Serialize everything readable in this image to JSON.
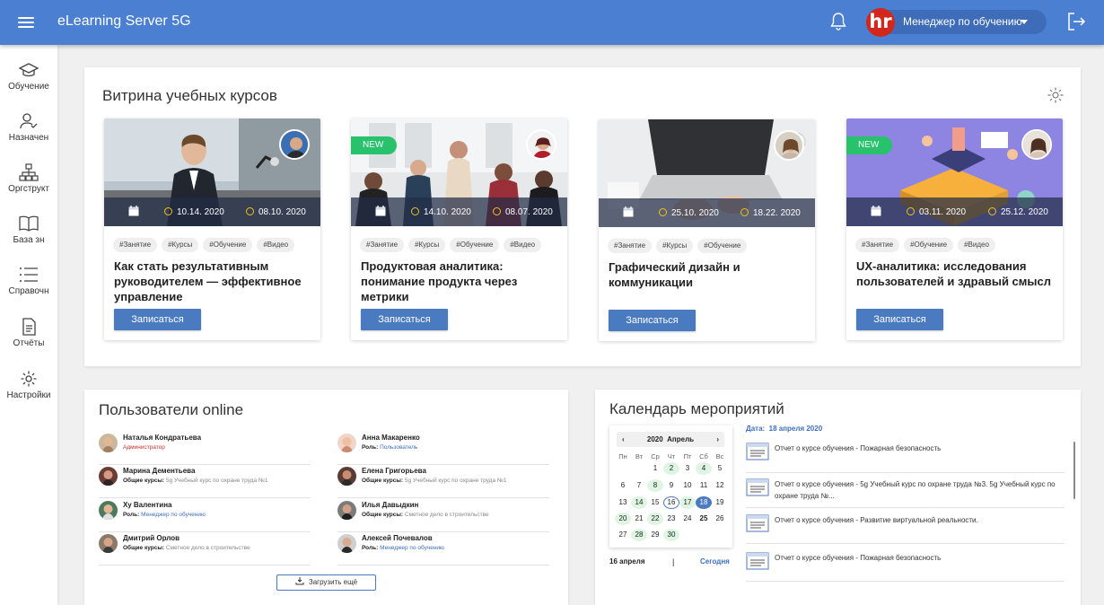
{
  "topbar": {
    "title": "eLearning Server 5G",
    "user_initial": "hr",
    "user_name": "Менеджер по обучению"
  },
  "sidebar": {
    "items": [
      {
        "label": "Обучение"
      },
      {
        "label": "Назначен"
      },
      {
        "label": "Оргструкт"
      },
      {
        "label": "База зн"
      },
      {
        "label": "Справочн"
      },
      {
        "label": "Отчёты"
      },
      {
        "label": "Настройки"
      }
    ]
  },
  "showcase": {
    "title": "Витрина учебных курсов",
    "courses": [
      {
        "date_start": "10.14. 2020",
        "date_end": "08.10. 2020",
        "new": "",
        "tags": [
          "#Занятие",
          "#Курсы",
          "#Обучение",
          "#Видео"
        ],
        "title": "Как стать результативным руководителем — эффективное управление",
        "button": "Записаться"
      },
      {
        "date_start": "14.10. 2020",
        "date_end": "08.07. 2020",
        "new": "NEW",
        "tags": [
          "#Занятие",
          "#Курсы",
          "#Обучение",
          "#Видео"
        ],
        "title": "Продуктовая аналитика: понимание продукта через метрики",
        "button": "Записаться"
      },
      {
        "date_start": "25.10. 2020",
        "date_end": "18.22. 2020",
        "new": "",
        "tags": [
          "#Занятие",
          "#Курсы",
          "#Обучение"
        ],
        "title": "Графический дизайн и коммуникации",
        "button": "Записаться"
      },
      {
        "date_start": "03.11. 2020",
        "date_end": "25.12. 2020",
        "new": "NEW",
        "tags": [
          "#Занятие",
          "#Обучение",
          "#Видео"
        ],
        "title": "UX-аналитика: исследования пользователей и здравый смысл",
        "button": "Записаться"
      }
    ]
  },
  "online": {
    "title": "Пользователи online",
    "load_more": "Загрузить ещё",
    "users": [
      {
        "name": "Наталья Кондратьева",
        "key": "",
        "value": "Администратор"
      },
      {
        "name": "Марина Дементьева",
        "key": "Общие курсы:",
        "value": "5g Учебный курс по охране труда №1"
      },
      {
        "name": "Ху Валентина",
        "key": "Роль:",
        "value": "Менеджер по обучению"
      },
      {
        "name": "Дмитрий Орлов",
        "key": "Общие курсы:",
        "value": "Сметное дело в строительстве"
      },
      {
        "name": "Анна Макаренко",
        "key": "Роль:",
        "value": "Пользователь"
      },
      {
        "name": "Елена Григорьева",
        "key": "Общие курсы:",
        "value": "5g Учебный курс по охране труда №1"
      },
      {
        "name": "Илья Давыдкин",
        "key": "Общие курсы:",
        "value": "Сметное дело в строительстве"
      },
      {
        "name": "Алексей Почевалов",
        "key": "Роль:",
        "value": "Менеджер по обучению"
      }
    ]
  },
  "calendar": {
    "title": "Календарь мероприятий",
    "year": "2020",
    "month": "Апрель",
    "weekdays": [
      "Пн",
      "Вт",
      "Ср",
      "Чт",
      "Пт",
      "Сб",
      "Вс"
    ],
    "days": [
      "1",
      "2",
      "3",
      "4",
      "5",
      "6",
      "7",
      "8",
      "9",
      "10",
      "11",
      "12",
      "13",
      "14",
      "15",
      "16",
      "17",
      "18",
      "19",
      "20",
      "21",
      "22",
      "23",
      "24",
      "25",
      "26",
      "27",
      "28",
      "29",
      "30"
    ],
    "footer_date": "16 апреля",
    "footer_sep": "|",
    "today": "Сегодня",
    "date_label": "Дата:",
    "date_value": "18 апреля 2020",
    "events": [
      "Отчет о курсе обучения - Пожарная безопасность",
      "Отчет о курсе обучения - 5g Учебный курс по охране труда №3. 5g Учебный курс по охране труда №...",
      "Отчет о курсе обучения - Развитие виртуальной реальности.",
      "Отчет о курсе обучения - Пожарная безопасность"
    ]
  },
  "colors": {
    "primary": "#4a7fd1",
    "new_badge": "#27c26b",
    "event_day": "#dff5e3",
    "admin_role": "#d23030"
  }
}
